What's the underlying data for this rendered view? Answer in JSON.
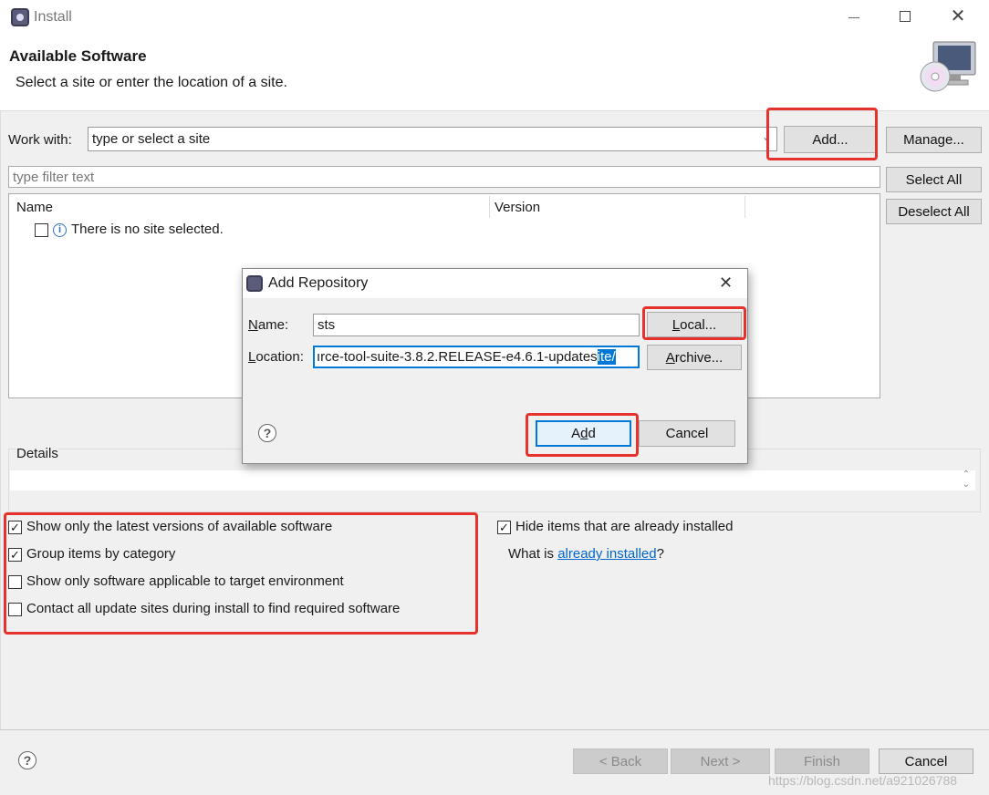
{
  "window": {
    "title": "Install",
    "minimize_icon": "minimize-icon",
    "maximize_icon": "maximize-icon",
    "close_icon": "close-icon"
  },
  "header": {
    "title": "Available Software",
    "description": "Select a site or enter the location of a site."
  },
  "work_with": {
    "label": "Work with:",
    "value": "type or select a site",
    "add_label": "Add...",
    "manage_label": "Manage..."
  },
  "filter": {
    "placeholder": "type filter text"
  },
  "table": {
    "columns": [
      "Name",
      "Version"
    ],
    "rows": [
      {
        "name": "There is no site selected.",
        "checked": false
      }
    ]
  },
  "side_buttons": {
    "select_all": "Select All",
    "deselect_all": "Deselect All"
  },
  "details": {
    "label": "Details"
  },
  "options": [
    {
      "label": "Show only the latest versions of available software",
      "checked": true
    },
    {
      "label": "Group items by category",
      "checked": true
    },
    {
      "label": "Show only software applicable to target environment",
      "checked": false
    },
    {
      "label": "Contact all update sites during install to find required software",
      "checked": false
    }
  ],
  "hide_installed": {
    "label": "Hide items that are already installed",
    "checked": true
  },
  "what_is": {
    "prefix": "What is ",
    "link": "already installed",
    "suffix": "?"
  },
  "footer": {
    "back": "< Back",
    "next": "Next >",
    "finish": "Finish",
    "cancel": "Cancel",
    "watermark": "https://blog.csdn.net/a921026788"
  },
  "dialog": {
    "title": "Add Repository",
    "name_label": "Name:",
    "name_value": "sts",
    "location_label": "Location:",
    "location_value": "ırce-tool-suite-3.8.2.RELEASE-e4.6.1-updates",
    "location_selected": "ite/",
    "local_label": "Local...",
    "archive_label": "Archive...",
    "add_label": "Add",
    "cancel_label": "Cancel"
  },
  "colors": {
    "highlight": "#e5322d",
    "link": "#0066cc",
    "selection": "#0078d7"
  }
}
